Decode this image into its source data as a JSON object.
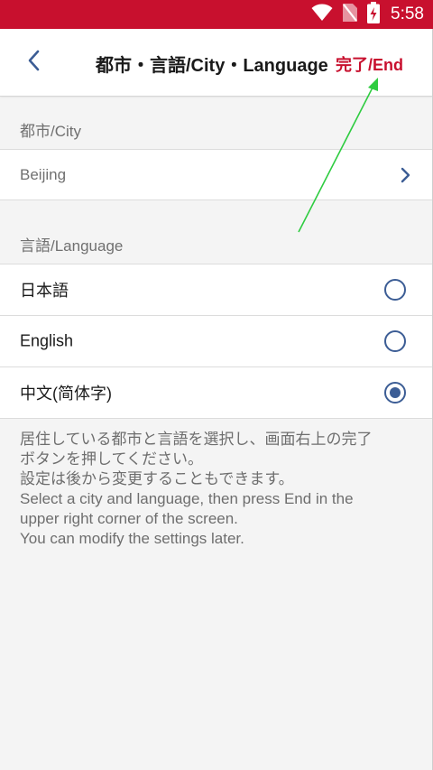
{
  "status_bar": {
    "time": "5:58",
    "icons": [
      "wifi-icon",
      "no-sim-icon",
      "battery-charging-icon"
    ],
    "background_color": "#c8102e"
  },
  "header": {
    "back_icon": "chevron-left-icon",
    "title": "都市・言語/City・Language",
    "done_label": "完了/End",
    "done_color": "#c8102e"
  },
  "city_section": {
    "label": "都市/City",
    "selected_city": "Beijing",
    "chevron_icon": "chevron-right-icon"
  },
  "language_section": {
    "label": "言語/Language",
    "options": [
      {
        "label": "日本語",
        "selected": false
      },
      {
        "label": "English",
        "selected": false
      },
      {
        "label": "中文(简体字)",
        "selected": true
      }
    ],
    "radio_color": "#3c5d95"
  },
  "help": {
    "lines": [
      "居住している都市と言語を選択し、画面右上の完了",
      "ボタンを押してください。",
      "設定は後から変更することもできます。",
      "Select a city and language, then press End in the",
      "upper right corner of the screen.",
      "You can modify the settings later."
    ]
  },
  "annotation": {
    "arrow_color": "#2ecc40"
  }
}
